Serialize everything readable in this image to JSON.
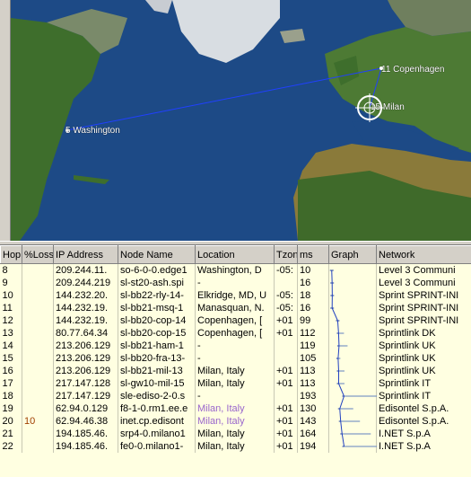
{
  "map": {
    "labels": [
      {
        "name": "washington",
        "text": "5 Washington"
      },
      {
        "name": "copenhagen",
        "text": "11 Copenhagen"
      },
      {
        "name": "milan",
        "text": "15 Milan"
      }
    ],
    "colors": {
      "ocean": "#1d4a86",
      "land": "#3b6b2a",
      "ice": "#e8ecf0",
      "route": "#2040ff"
    }
  },
  "table": {
    "columns": [
      "Hop",
      "%Loss",
      "IP Address",
      "Node Name",
      "Location",
      "Tzone",
      "ms",
      "Graph",
      "Network"
    ],
    "rows": [
      {
        "hop": "8",
        "loss": "",
        "ip": "209.244.11.",
        "node": "so-6-0-0.edge1",
        "loc": "Washington, D",
        "tz": "-05:",
        "ms": "10",
        "net": "Level 3 Communi",
        "purple": false
      },
      {
        "hop": "9",
        "loss": "",
        "ip": "209.244.219",
        "node": "sl-st20-ash.spi",
        "loc": "-",
        "tz": "",
        "ms": "16",
        "net": "Level 3 Communi",
        "purple": false
      },
      {
        "hop": "10",
        "loss": "",
        "ip": "144.232.20.",
        "node": "sl-bb22-rly-14-",
        "loc": "Elkridge, MD, U",
        "tz": "-05:",
        "ms": "18",
        "net": "Sprint SPRINT-INI",
        "purple": false
      },
      {
        "hop": "11",
        "loss": "",
        "ip": "144.232.19.",
        "node": "sl-bb21-msq-1",
        "loc": "Manasquan, N.",
        "tz": "-05:",
        "ms": "16",
        "net": "Sprint SPRINT-INI",
        "purple": false
      },
      {
        "hop": "12",
        "loss": "",
        "ip": "144.232.19.",
        "node": "sl-bb20-cop-14",
        "loc": "Copenhagen, [",
        "tz": "+01",
        "ms": "99",
        "net": "Sprint SPRINT-INI",
        "purple": false
      },
      {
        "hop": "13",
        "loss": "",
        "ip": "80.77.64.34",
        "node": "sl-bb20-cop-15",
        "loc": "Copenhagen, [",
        "tz": "+01",
        "ms": "112",
        "net": "Sprintlink DK",
        "purple": false
      },
      {
        "hop": "14",
        "loss": "",
        "ip": "213.206.129",
        "node": "sl-bb21-ham-1",
        "loc": "-",
        "tz": "",
        "ms": "119",
        "net": "Sprintlink UK",
        "purple": false
      },
      {
        "hop": "15",
        "loss": "",
        "ip": "213.206.129",
        "node": "sl-bb20-fra-13-",
        "loc": "-",
        "tz": "",
        "ms": "105",
        "net": "Sprintlink UK",
        "purple": false
      },
      {
        "hop": "16",
        "loss": "",
        "ip": "213.206.129",
        "node": "sl-bb21-mil-13",
        "loc": "Milan, Italy",
        "tz": "+01",
        "ms": "113",
        "net": "Sprintlink UK",
        "purple": false
      },
      {
        "hop": "17",
        "loss": "",
        "ip": "217.147.128",
        "node": "sl-gw10-mil-15",
        "loc": "Milan, Italy",
        "tz": "+01",
        "ms": "113",
        "net": "Sprintlink IT",
        "purple": false
      },
      {
        "hop": "18",
        "loss": "",
        "ip": "217.147.129",
        "node": "sle-ediso-2-0.s",
        "loc": "-",
        "tz": "",
        "ms": "193",
        "net": "Sprintlink IT",
        "purple": false
      },
      {
        "hop": "19",
        "loss": "",
        "ip": "62.94.0.129",
        "node": "f8-1-0.rm1.ee.e",
        "loc": "Milan, Italy",
        "tz": "+01",
        "ms": "130",
        "net": "Edisontel S.p.A.",
        "purple": true
      },
      {
        "hop": "20",
        "loss": "10",
        "ip": "62.94.46.38",
        "node": "inet.cp.edisont",
        "loc": "Milan, Italy",
        "tz": "+01",
        "ms": "143",
        "net": "Edisontel S.p.A.",
        "purple": true
      },
      {
        "hop": "21",
        "loss": "",
        "ip": "194.185.46.",
        "node": "srp4-0.milano1",
        "loc": "Milan, Italy",
        "tz": "+01",
        "ms": "164",
        "net": "I.NET S.p.A",
        "purple": false
      },
      {
        "hop": "22",
        "loss": "",
        "ip": "194.185.46.",
        "node": "fe0-0.milano1-",
        "loc": "Milan, Italy",
        "tz": "+01",
        "ms": "194",
        "net": "I.NET S.p.A",
        "purple": false
      }
    ]
  },
  "graph_ms": [
    10,
    16,
    18,
    16,
    99,
    112,
    119,
    105,
    113,
    113,
    193,
    130,
    143,
    164,
    194
  ]
}
